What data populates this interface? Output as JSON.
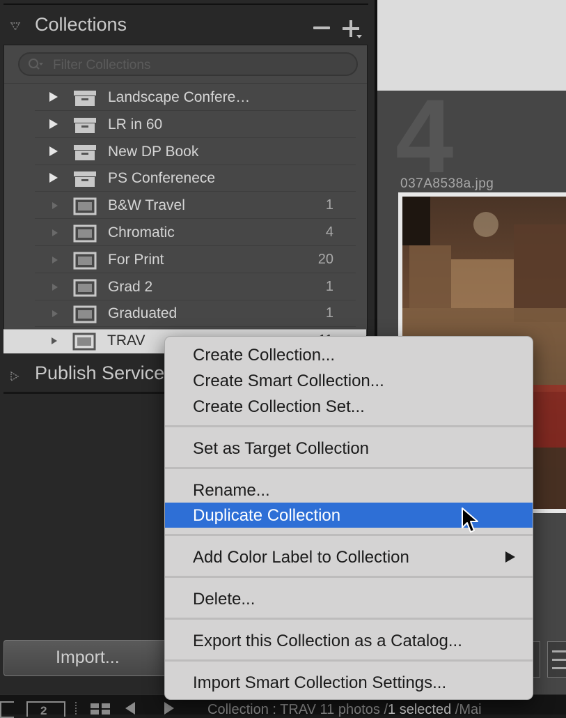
{
  "collections_panel": {
    "title": "Collections",
    "filter_placeholder": "Filter Collections",
    "rows": [
      {
        "name": "Landscape Confere…",
        "count": "",
        "type": "set"
      },
      {
        "name": "LR in 60",
        "count": "",
        "type": "set"
      },
      {
        "name": "New DP Book",
        "count": "",
        "type": "set"
      },
      {
        "name": "PS Conferenece",
        "count": "",
        "type": "set"
      },
      {
        "name": "B&W Travel",
        "count": "1",
        "type": "collection"
      },
      {
        "name": "Chromatic",
        "count": "4",
        "type": "collection"
      },
      {
        "name": "For Print",
        "count": "20",
        "type": "collection"
      },
      {
        "name": "Grad 2",
        "count": "1",
        "type": "collection"
      },
      {
        "name": "Graduated",
        "count": "1",
        "type": "collection"
      }
    ],
    "selected_row": {
      "name": "TRAV",
      "count": "11"
    }
  },
  "publish_panel": {
    "title": "Publish Services"
  },
  "import_button": "Import...",
  "grid": {
    "cell_number": "4",
    "filename": "037A8538a.jpg"
  },
  "bottom_bar": {
    "page_box": "2",
    "status_prefix": "Collection : TRAV    11 photos /",
    "status_selected": "1 selected",
    "status_suffix": " /Mai"
  },
  "context_menu": {
    "items": [
      "Create Collection...",
      "Create Smart Collection...",
      "Create Collection Set...",
      "Set as Target Collection",
      "Rename...",
      "Duplicate Collection",
      "Add Color Label to Collection",
      "Delete...",
      "Export this Collection as a Catalog...",
      "Import Smart Collection Settings..."
    ],
    "highlighted_item": "Duplicate Collection",
    "highlight_color": "#2e6fd6"
  }
}
